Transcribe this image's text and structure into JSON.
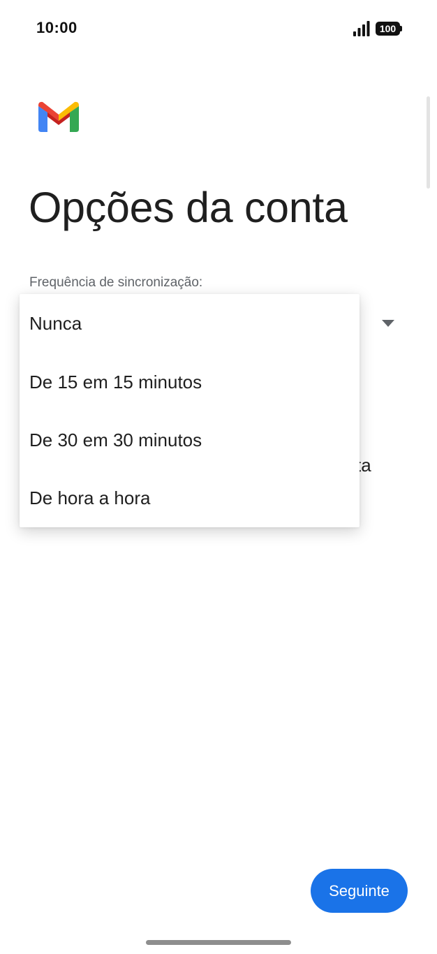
{
  "status_bar": {
    "time": "10:00",
    "battery": "100",
    "signal_icon": "signal-icon",
    "battery_icon": "battery-icon"
  },
  "app": {
    "logo": "gmail-logo",
    "title": "Opções da conta"
  },
  "sync": {
    "label": "Frequência de sincronização:",
    "dropdown_icon": "arrow-drop-down-icon",
    "options": [
      "Nunca",
      "De 15 em 15 minutos",
      "De 30 em 30 minutos",
      "De hora a hora"
    ]
  },
  "background_text": {
    "partial": "ta"
  },
  "footer": {
    "next_label": "Seguinte"
  },
  "colors": {
    "accent": "#1a73e8",
    "gmail_red": "#ea4335",
    "gmail_blue": "#4285f4",
    "gmail_green": "#34a853",
    "gmail_yellow": "#fbbc04"
  }
}
